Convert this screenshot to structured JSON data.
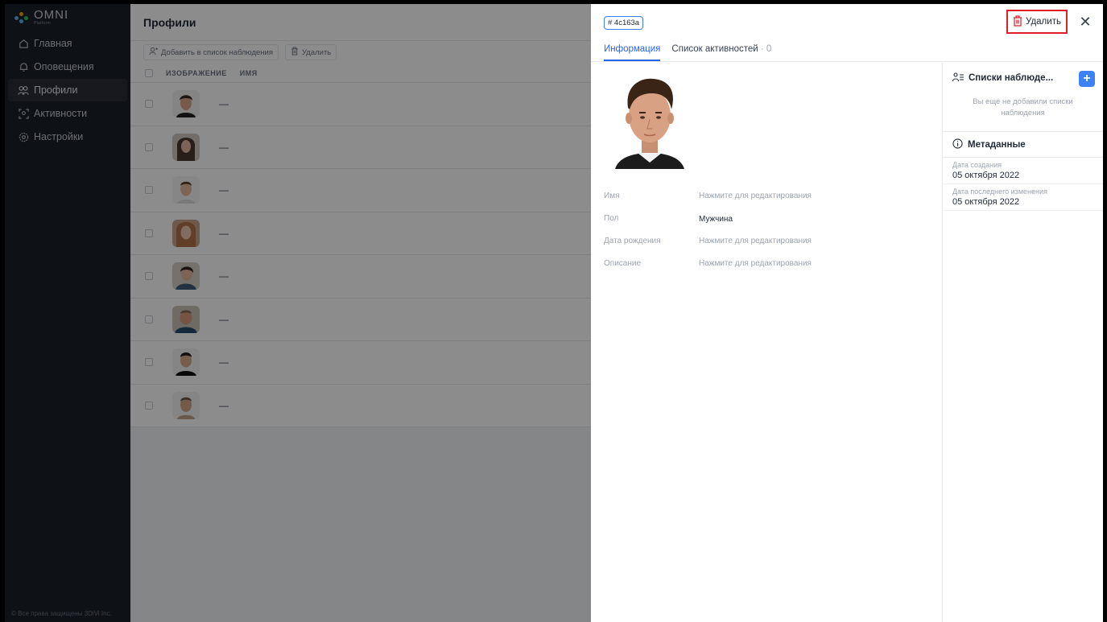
{
  "app": {
    "logo_text": "OMNI",
    "logo_sub": "Platform"
  },
  "sidebar": {
    "items": [
      {
        "label": "Главная",
        "icon": "home-icon",
        "active": false
      },
      {
        "label": "Оповещения",
        "icon": "bell-icon",
        "active": false
      },
      {
        "label": "Профили",
        "icon": "profiles-icon",
        "active": true
      },
      {
        "label": "Активности",
        "icon": "activity-icon",
        "active": false
      },
      {
        "label": "Настройки",
        "icon": "gear-icon",
        "active": false
      }
    ],
    "copyright": "© Все права защищены 3DiVi Inc."
  },
  "main": {
    "title": "Профили",
    "toolbar": {
      "add_watchlist": "Добавить в список наблюдения",
      "delete": "Удалить"
    },
    "table": {
      "headers": {
        "image": "ИЗОБРАЖЕНИЕ",
        "name": "ИМЯ"
      },
      "rows": [
        {
          "name": "—"
        },
        {
          "name": "—"
        },
        {
          "name": "—"
        },
        {
          "name": "—"
        },
        {
          "name": "—"
        },
        {
          "name": "—"
        },
        {
          "name": "—"
        },
        {
          "name": "—"
        }
      ]
    }
  },
  "panel": {
    "id": "# 4c163a",
    "delete_label": "Удалить",
    "tabs": [
      {
        "label": "Информация",
        "active": true
      },
      {
        "label": "Список активностей",
        "count": "· 0",
        "active": false
      }
    ],
    "fields": [
      {
        "label": "Имя",
        "value": "Нажмите для редактирования",
        "filled": false
      },
      {
        "label": "Пол",
        "value": "Мужчина",
        "filled": true
      },
      {
        "label": "Дата рождения",
        "value": "Нажмите для редактирования",
        "filled": false
      },
      {
        "label": "Описание",
        "value": "Нажмите для редактирования",
        "filled": false
      }
    ],
    "watchlists": {
      "title": "Списки наблюде...",
      "empty_text": "Вы еще не добавили списки наблюдения"
    },
    "metadata": {
      "title": "Метаданные",
      "created_label": "Дата создания",
      "created_value": "05 октября 2022",
      "modified_label": "Дата последнего изменения",
      "modified_value": "05 октября 2022"
    }
  },
  "colors": {
    "accent": "#2563eb",
    "sidebar_bg": "#1b1f27",
    "delete_highlight": "#e11d2a"
  }
}
